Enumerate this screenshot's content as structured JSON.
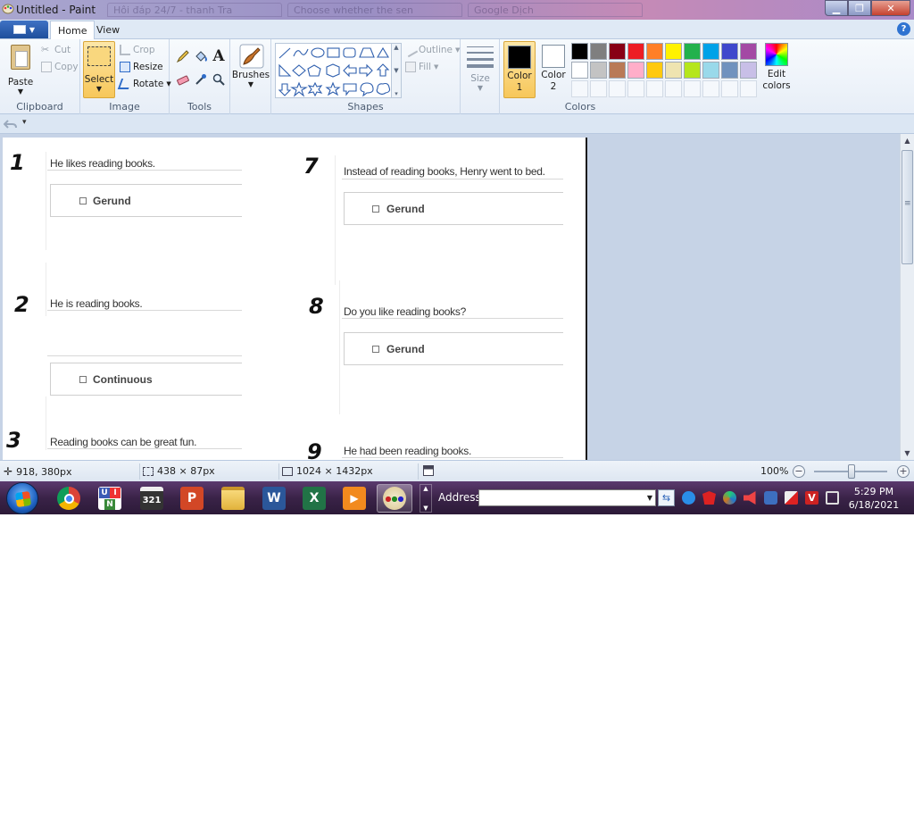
{
  "window": {
    "title": "Untitled - Paint",
    "background_tabs": [
      "Hôi đáp 24/7 - thanh Tra",
      "Choose whether the sen",
      "Google Dịch"
    ]
  },
  "ribbon_tabs": [
    "Home",
    "View"
  ],
  "clipboard": {
    "paste": "Paste",
    "cut": "Cut",
    "copy": "Copy",
    "group": "Clipboard"
  },
  "image": {
    "select": "Select",
    "crop": "Crop",
    "resize": "Resize",
    "rotate": "Rotate",
    "group": "Image"
  },
  "tools": {
    "group": "Tools"
  },
  "brushes": {
    "label": "Brushes"
  },
  "shapes": {
    "outline": "Outline",
    "fill": "Fill",
    "group": "Shapes"
  },
  "size": {
    "label": "Size"
  },
  "colors": {
    "color1": "Color 1",
    "color2": "Color 2",
    "edit": "Edit colors",
    "group": "Colors",
    "color1_value": "#000000",
    "color2_value": "#ffffff",
    "palette": [
      "#000000",
      "#7f7f7f",
      "#880015",
      "#ed1c24",
      "#ff7f27",
      "#fff200",
      "#22b14c",
      "#00a2e8",
      "#3f48cc",
      "#a349a4",
      "#ffffff",
      "#c3c3c3",
      "#b97a57",
      "#ffaec9",
      "#ffc90e",
      "#efe4b0",
      "#b5e61d",
      "#99d9ea",
      "#7092be",
      "#c8bfe7"
    ]
  },
  "worksheet": {
    "questions": [
      {
        "num": "1",
        "text": "He likes reading books.",
        "answer": "Gerund"
      },
      {
        "num": "7",
        "text": "Instead of reading books, Henry went to bed.",
        "answer": "Gerund"
      },
      {
        "num": "2",
        "text": "He is reading books.",
        "answer": "Continuous"
      },
      {
        "num": "8",
        "text": "Do you like reading books?",
        "answer": "Gerund"
      },
      {
        "num": "3",
        "text": "Reading books can be great fun."
      },
      {
        "num": "9",
        "text": "He had been reading books."
      }
    ]
  },
  "status": {
    "cursor": "918, 380px",
    "selection": "438 × 87px",
    "canvas_size": "1024 × 1432px",
    "zoom": "100%",
    "zoom_level": 1.0
  },
  "taskbar": {
    "address_label": "Address",
    "address_value": "",
    "time": "5:29 PM",
    "date": "6/18/2021"
  }
}
